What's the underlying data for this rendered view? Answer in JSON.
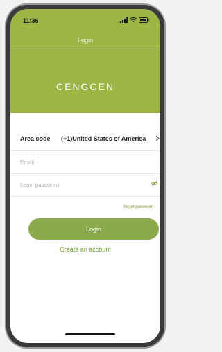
{
  "status_bar": {
    "time": "11:36"
  },
  "nav": {
    "title": "Login"
  },
  "brand": {
    "name": "CENGCEN"
  },
  "form": {
    "area_code_label": "Area code",
    "area_code_value": "(+1)United States of America",
    "email_placeholder": "Email",
    "password_placeholder": "Login password",
    "forgot_password": "forget password"
  },
  "actions": {
    "login_label": "Login",
    "create_account": "Create an account"
  },
  "colors": {
    "accent": "#9db544",
    "button": "#8aab4c",
    "link": "#6f9a2a"
  },
  "icons": {
    "area_chevron": "chevron-right-icon",
    "password_visibility": "eye-off-icon",
    "signal": "signal-icon",
    "wifi": "wifi-icon",
    "battery": "battery-icon"
  }
}
